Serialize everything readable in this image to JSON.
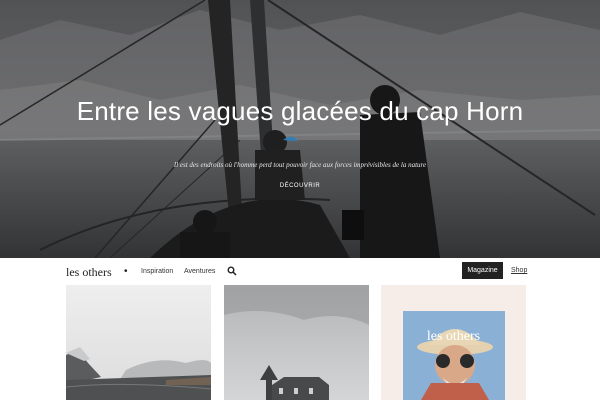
{
  "hero": {
    "title": "Entre les vagues glacées du cap Horn",
    "subtitle": "Il est des endroits où l'homme perd tout pouvoir face aux forces imprévisibles de la nature",
    "cta": "DÉCOUVRIR"
  },
  "nav": {
    "brand": "les others",
    "separator": "•",
    "links": [
      "Inspiration",
      "Aventures"
    ],
    "magazine": "Magazine",
    "shop": "Shop"
  },
  "cards": [
    {
      "icon": "mountain-landscape-image"
    },
    {
      "icon": "church-landscape-image"
    },
    {
      "title": "les others",
      "icon": "magazine-cover-image"
    }
  ],
  "colors": {
    "nav_button_bg": "#222222",
    "hero_accent": "#3b8fd0"
  }
}
